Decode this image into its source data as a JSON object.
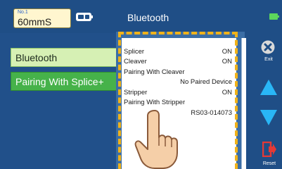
{
  "header": {
    "program_no": "No.1",
    "program_name": "60mmS",
    "title": "Bluetooth"
  },
  "menu": {
    "items": [
      {
        "label": "Bluetooth",
        "selected": true
      },
      {
        "label": "Pairing With Splice+",
        "selected": false
      }
    ]
  },
  "panel": {
    "rows": [
      {
        "label": "Splicer",
        "value": "ON"
      },
      {
        "label": "Cleaver",
        "value": "ON"
      },
      {
        "label": "Pairing With Cleaver",
        "value": ""
      },
      {
        "label": "",
        "value": "No Paired Device"
      },
      {
        "label": "Stripper",
        "value": "ON"
      },
      {
        "label": "Pairing With Stripper",
        "value": ""
      },
      {
        "label": "",
        "value": "RS03-014073"
      }
    ]
  },
  "controls": {
    "exit_label": "Exit",
    "reset_label": "Reset"
  },
  "colors": {
    "background": "#1f4e86",
    "selected_menu": "#d6f0b4",
    "menu_green": "#46b24a",
    "highlight_dash": "#f0b21a",
    "arrow": "#29b6f6",
    "reset": "#e53935"
  },
  "icons": [
    "cleaver-icon",
    "battery-icon",
    "exit-icon",
    "up-arrow-icon",
    "down-arrow-icon",
    "reset-icon",
    "pointing-hand-icon"
  ]
}
